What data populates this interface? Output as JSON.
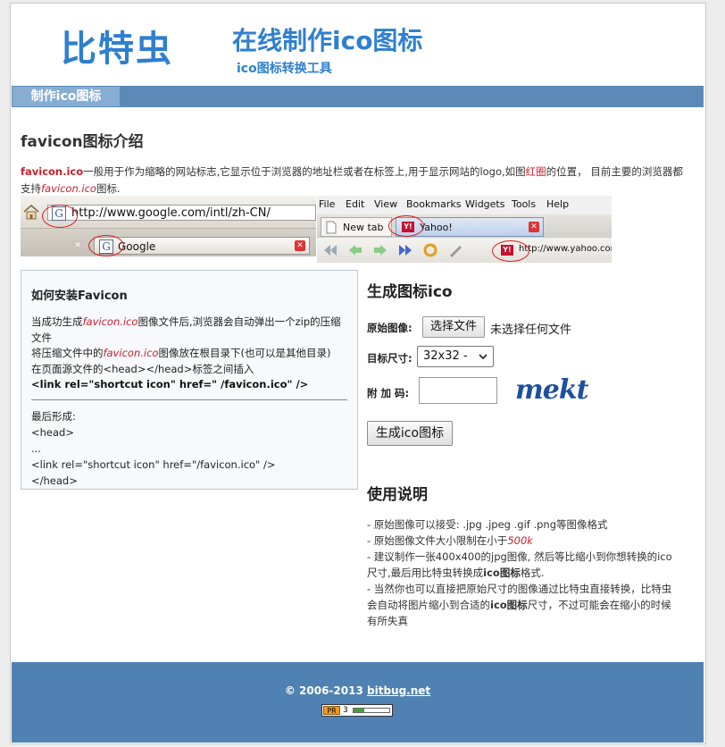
{
  "header": {
    "logo_text": "比特虫",
    "title": "在线制作ico图标",
    "subtitle": "ico图标转换工具"
  },
  "nav": {
    "items": [
      {
        "label": "制作ico图标",
        "active": true
      }
    ]
  },
  "intro": {
    "heading": "favicon图标介绍",
    "keyword": "favicon.ico",
    "text_part1": "一般用于作为缩略的网站标志,它显示位于浏览器的地址栏或者在标签上,用于显示网站的logo,如图",
    "red_ring_word": "红圈",
    "text_part2": "的位置， 目前主要的浏览器都支持",
    "keyword_italic": "favicon.ico",
    "text_part3": "图标."
  },
  "screenshot_left": {
    "url": "http://www.google.com/intl/zh-CN/",
    "tab_title": "Google",
    "favicon_letter": "G"
  },
  "screenshot_right": {
    "menu": [
      "File",
      "Edit",
      "View",
      "Bookmarks",
      "Widgets",
      "Tools",
      "Help"
    ],
    "tab_new": "New tab",
    "tab_yahoo": "Yahoo!",
    "url": "http://www.yahoo.com",
    "favicon_text": "Y!"
  },
  "install": {
    "title": "如何安装Favicon",
    "line1_a": "当成功生成",
    "line1_keyword": "favicon.ico",
    "line1_b": "图像文件后,浏览器会自动弹出一个zip的压缩文件",
    "line2_a": "将压缩文件中的",
    "line2_keyword": "favicon.ico",
    "line2_b": "图像放在根目录下(也可以是其他目录)",
    "line3": "在页面源文件的<head></head>标签之间插入",
    "line4": "<link rel=\"shortcut icon\" href=\" /favicon.ico\" />",
    "result_label": "最后形成:",
    "result_lines": [
      "<head>",
      "...",
      "<link rel=\"shortcut icon\" href=\"/favicon.ico\" />",
      "</head>"
    ]
  },
  "generator": {
    "heading": "生成图标ico",
    "source_label": "原始图像:",
    "file_button": "选择文件",
    "file_status": "未选择任何文件",
    "size_label": "目标尺寸:",
    "size_selected": "32x32 -",
    "code_label": "附 加 码:",
    "code_value": "",
    "captcha_text": "mekt",
    "submit_label": "生成ico图标"
  },
  "usage": {
    "heading": "使用说明",
    "item1": "- 原始图像可以接受: .jpg .jpeg .gif .png等图像格式",
    "item2_a": "- 原始图像文件大小限制在小于",
    "item2_limit": "500k",
    "item3_a": "- 建议制作一张400x400的jpg图像, 然后等比缩小到你想转换的ico尺寸,最后用比特虫转换成",
    "item3_bold": "ico图标",
    "item3_b": "格式.",
    "item4_a": "- 当然你也可以直接把原始尺寸的图像通过比特虫直接转换，比特虫会自动将图片缩小到合适的",
    "item4_bold": "ico图标",
    "item4_b": "尺寸，不过可能会在缩小的时候有所失真"
  },
  "footer": {
    "copyright_prefix": "© 2006-2013",
    "site_link": "bitbug.net",
    "pr_label": "PR",
    "pr_value": "3",
    "pr_level": 0.3
  },
  "colors": {
    "brand_blue": "#2f7fd0",
    "nav_bar": "#5b8ab8",
    "nav_active": "#88add3",
    "footer": "#4f82b2",
    "accent_red": "#c8202a"
  }
}
